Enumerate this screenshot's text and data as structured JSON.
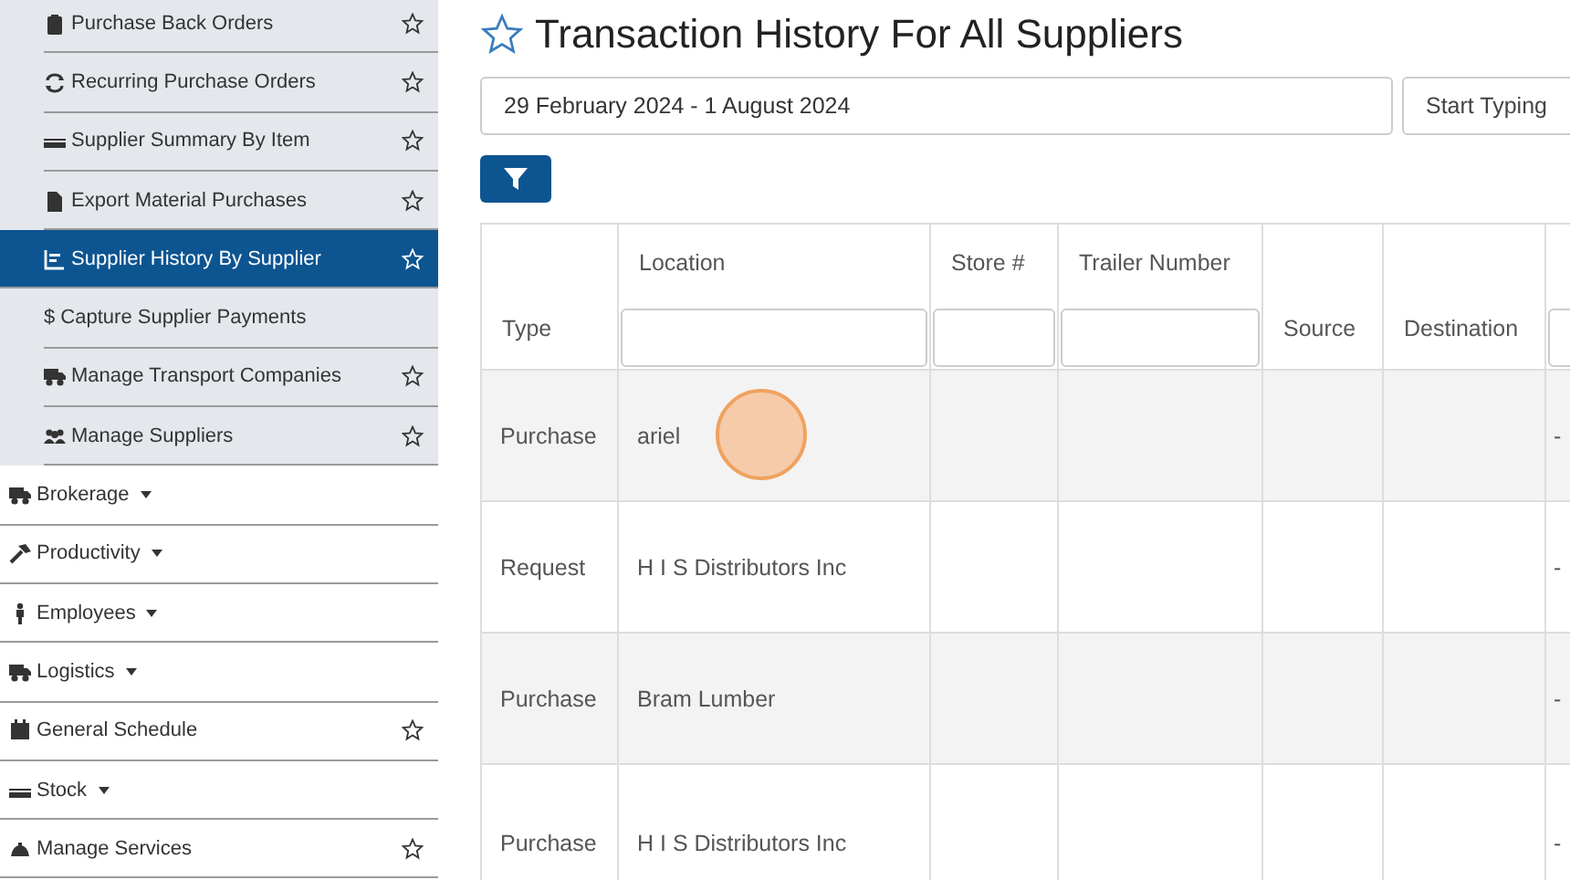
{
  "sidebar": {
    "items": [
      {
        "kind": "sub",
        "label": "Purchase Back Orders",
        "selected": false,
        "star": true,
        "caret": false
      },
      {
        "kind": "sub",
        "label": "Recurring Purchase Orders",
        "selected": false,
        "star": true,
        "caret": false
      },
      {
        "kind": "sub",
        "label": "Supplier Summary By Item",
        "selected": false,
        "star": true,
        "caret": false
      },
      {
        "kind": "sub",
        "label": "Export Material Purchases",
        "selected": false,
        "star": true,
        "caret": false
      },
      {
        "kind": "sub",
        "label": "Supplier History By Supplier",
        "selected": true,
        "star": true,
        "caret": false
      },
      {
        "kind": "sub",
        "label": "$ Capture Supplier Payments",
        "selected": false,
        "star": false,
        "caret": false
      },
      {
        "kind": "sub",
        "label": "Manage Transport Companies",
        "selected": false,
        "star": true,
        "caret": false
      },
      {
        "kind": "sub",
        "label": "Manage Suppliers",
        "selected": false,
        "star": true,
        "caret": false
      },
      {
        "kind": "top",
        "label": "Brokerage",
        "selected": false,
        "star": false,
        "caret": true
      },
      {
        "kind": "top",
        "label": "Productivity",
        "selected": false,
        "star": false,
        "caret": true
      },
      {
        "kind": "top",
        "label": "Employees",
        "selected": false,
        "star": false,
        "caret": true
      },
      {
        "kind": "top",
        "label": "Logistics",
        "selected": false,
        "star": false,
        "caret": true
      },
      {
        "kind": "top",
        "label": "General Schedule",
        "selected": false,
        "star": true,
        "caret": false
      },
      {
        "kind": "top",
        "label": "Stock",
        "selected": false,
        "star": false,
        "caret": true
      },
      {
        "kind": "top",
        "label": "Manage Services",
        "selected": false,
        "star": true,
        "caret": false
      }
    ]
  },
  "page": {
    "title": "Transaction History For All Suppliers",
    "date_range": {
      "value": "29 February 2024 - 1 August 2024"
    },
    "search": {
      "placeholder": "Start Typing"
    }
  },
  "table": {
    "columns": [
      {
        "label": "Type",
        "filter": false
      },
      {
        "label": "Location",
        "filter": true
      },
      {
        "label": "Store #",
        "filter": true
      },
      {
        "label": "Trailer Number",
        "filter": true
      },
      {
        "label": "Source",
        "filter": false
      },
      {
        "label": "Destination",
        "filter": false
      },
      {
        "filter": true
      }
    ],
    "rows": [
      {
        "clicked": true,
        "cells": [
          "Purchase",
          "ariel",
          "",
          "",
          "",
          "",
          "-"
        ]
      },
      {
        "clicked": false,
        "cells": [
          "Request",
          "H I S Distributors Inc",
          "",
          "",
          "",
          "",
          "-"
        ]
      },
      {
        "clicked": false,
        "cells": [
          "Purchase",
          "Bram Lumber",
          "",
          "",
          "",
          "",
          "-"
        ]
      },
      {
        "clicked": false,
        "cells": [
          "Purchase",
          "H I S Distributors Inc",
          "",
          "",
          "",
          "",
          "-"
        ]
      }
    ]
  }
}
